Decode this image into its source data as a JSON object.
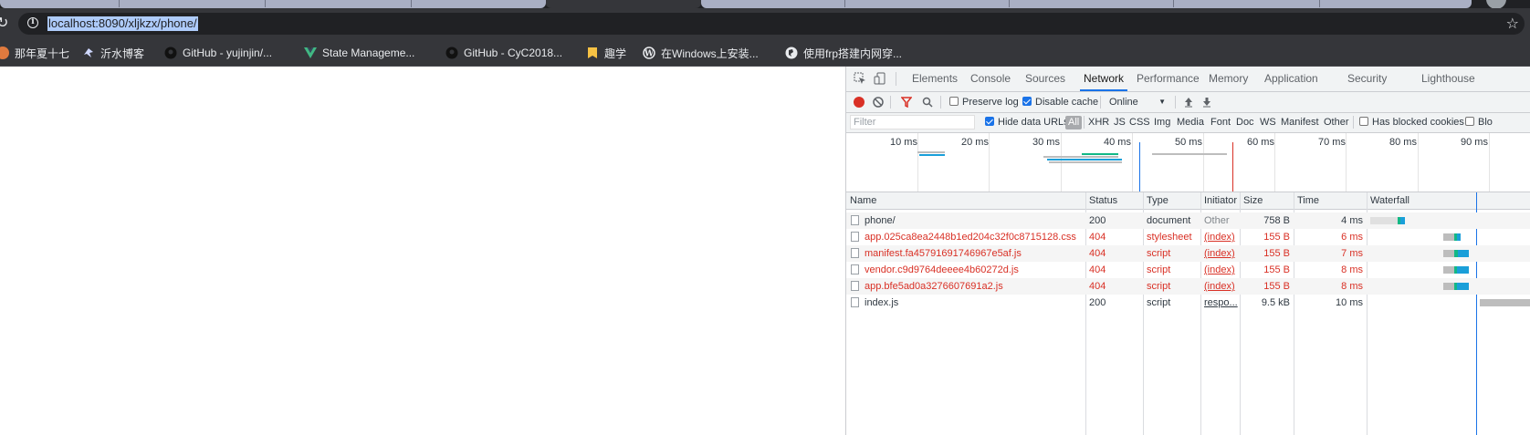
{
  "browser": {
    "url": "localhost:8090/xljkzx/phone/"
  },
  "bookmarks": [
    {
      "label": "那年夏十七",
      "icon": "avatar-icon",
      "color": "#e07a3e"
    },
    {
      "label": "沂水博客",
      "icon": "bird-icon",
      "color": "#cfd8ff"
    },
    {
      "label": "GitHub - yujinjin/...",
      "icon": "github-icon",
      "color": "#111"
    },
    {
      "label": "State Manageme...",
      "icon": "vue-icon",
      "color": "#41b883"
    },
    {
      "label": "GitHub - CyC2018...",
      "icon": "github-icon",
      "color": "#111"
    },
    {
      "label": "趣学",
      "icon": "bookmark-folder-icon",
      "color": "#f6c244"
    },
    {
      "label": "在Windows上安装...",
      "icon": "wordpress-icon",
      "color": "#e8eaed"
    },
    {
      "label": "使用frp搭建内网穿...",
      "icon": "globe-icon",
      "color": "#e8eaed"
    }
  ],
  "devtools": {
    "tabs": [
      "Elements",
      "Console",
      "Sources",
      "Network",
      "Performance",
      "Memory",
      "Application",
      "Security",
      "Lighthouse"
    ],
    "active_tab": "Network",
    "toolbar": {
      "preserve_log": "Preserve log",
      "disable_cache": "Disable cache",
      "throttle": "Online"
    },
    "filter": {
      "placeholder": "Filter",
      "hide_data_urls": "Hide data URLs",
      "types": [
        "All",
        "XHR",
        "JS",
        "CSS",
        "Img",
        "Media",
        "Font",
        "Doc",
        "WS",
        "Manifest",
        "Other"
      ],
      "has_blocked_cookies": "Has blocked cookies",
      "blocked_requests": "Blo"
    },
    "overview_ticks": [
      "10 ms",
      "20 ms",
      "30 ms",
      "40 ms",
      "50 ms",
      "60 ms",
      "70 ms",
      "80 ms",
      "90 ms"
    ],
    "columns": [
      "Name",
      "Status",
      "Type",
      "Initiator",
      "Size",
      "Time",
      "Waterfall"
    ],
    "requests": [
      {
        "name": "phone/",
        "status": "200",
        "type": "document",
        "initiator": "Other",
        "size": "758 B",
        "time": "4 ms",
        "error": false
      },
      {
        "name": "app.025ca8ea2448b1ed204c32f0c8715128.css",
        "status": "404",
        "type": "stylesheet",
        "initiator": "(index)",
        "size": "155 B",
        "time": "6 ms",
        "error": true
      },
      {
        "name": "manifest.fa45791691746967e5af.js",
        "status": "404",
        "type": "script",
        "initiator": "(index)",
        "size": "155 B",
        "time": "7 ms",
        "error": true
      },
      {
        "name": "vendor.c9d9764deeee4b60272d.js",
        "status": "404",
        "type": "script",
        "initiator": "(index)",
        "size": "155 B",
        "time": "8 ms",
        "error": true
      },
      {
        "name": "app.bfe5ad0a3276607691a2.js",
        "status": "404",
        "type": "script",
        "initiator": "(index)",
        "size": "155 B",
        "time": "8 ms",
        "error": true
      },
      {
        "name": "index.js",
        "status": "200",
        "type": "script",
        "initiator": "respo...",
        "size": "9.5 kB",
        "time": "10 ms",
        "error": false
      }
    ]
  }
}
